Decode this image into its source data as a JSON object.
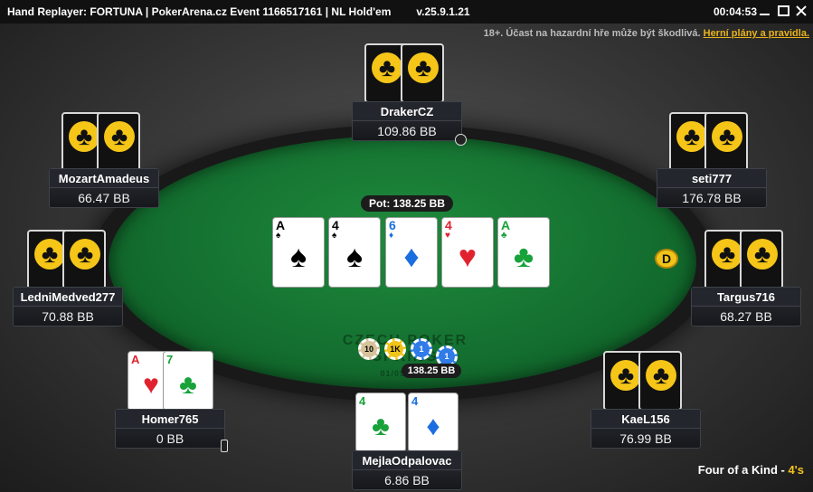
{
  "window": {
    "title": "Hand Replayer: FORTUNA | PokerArena.cz Event 1166517161 | NL Hold'em",
    "version": "v.25.9.1.21",
    "clock": "00:04:53"
  },
  "disclaimer": {
    "text": "18+. Účast na hazardní hře může být škodlivá.",
    "link": "Herní plány a pravidla."
  },
  "pot": {
    "label": "Pot: 138.25 BB",
    "chips_total": "138.25 BB",
    "chips": [
      "10",
      "1K",
      "1",
      "1"
    ]
  },
  "board": [
    {
      "rank": "A",
      "suit": "♠",
      "color": "#000000"
    },
    {
      "rank": "4",
      "suit": "♠",
      "color": "#000000"
    },
    {
      "rank": "6",
      "suit": "♦",
      "color": "#1b6ee0"
    },
    {
      "rank": "4",
      "suit": "♥",
      "color": "#e0222e"
    },
    {
      "rank": "A",
      "suit": "♣",
      "color": "#17a23a"
    }
  ],
  "players": [
    {
      "name": "DrakerCZ",
      "stack": "109.86 BB"
    },
    {
      "name": "seti777",
      "stack": "176.78 BB"
    },
    {
      "name": "Targus716",
      "stack": "68.27 BB"
    },
    {
      "name": "KaeL156",
      "stack": "76.99 BB"
    },
    {
      "name": "MejlaOdpalovac",
      "stack": "6.86 BB",
      "cards": [
        {
          "rank": "4",
          "suit": "♣",
          "color": "#17a23a"
        },
        {
          "rank": "4",
          "suit": "♦",
          "color": "#1b6ee0"
        }
      ]
    },
    {
      "name": "Homer765",
      "stack": "0 BB",
      "cards": [
        {
          "rank": "A",
          "suit": "♥",
          "color": "#e0222e"
        },
        {
          "rank": "7",
          "suit": "♣",
          "color": "#17a23a"
        }
      ]
    },
    {
      "name": "LedniMedved277",
      "stack": "70.88 BB"
    },
    {
      "name": "MozartAmadeus",
      "stack": "66.47 BB"
    }
  ],
  "dealer_button": "D",
  "felt_logo": {
    "line1": "CZECH POKER",
    "line2": "SPRING",
    "line3": "01/05/2025"
  },
  "hand_result": {
    "text": "Four of a Kind - ",
    "highlight": "4's"
  }
}
